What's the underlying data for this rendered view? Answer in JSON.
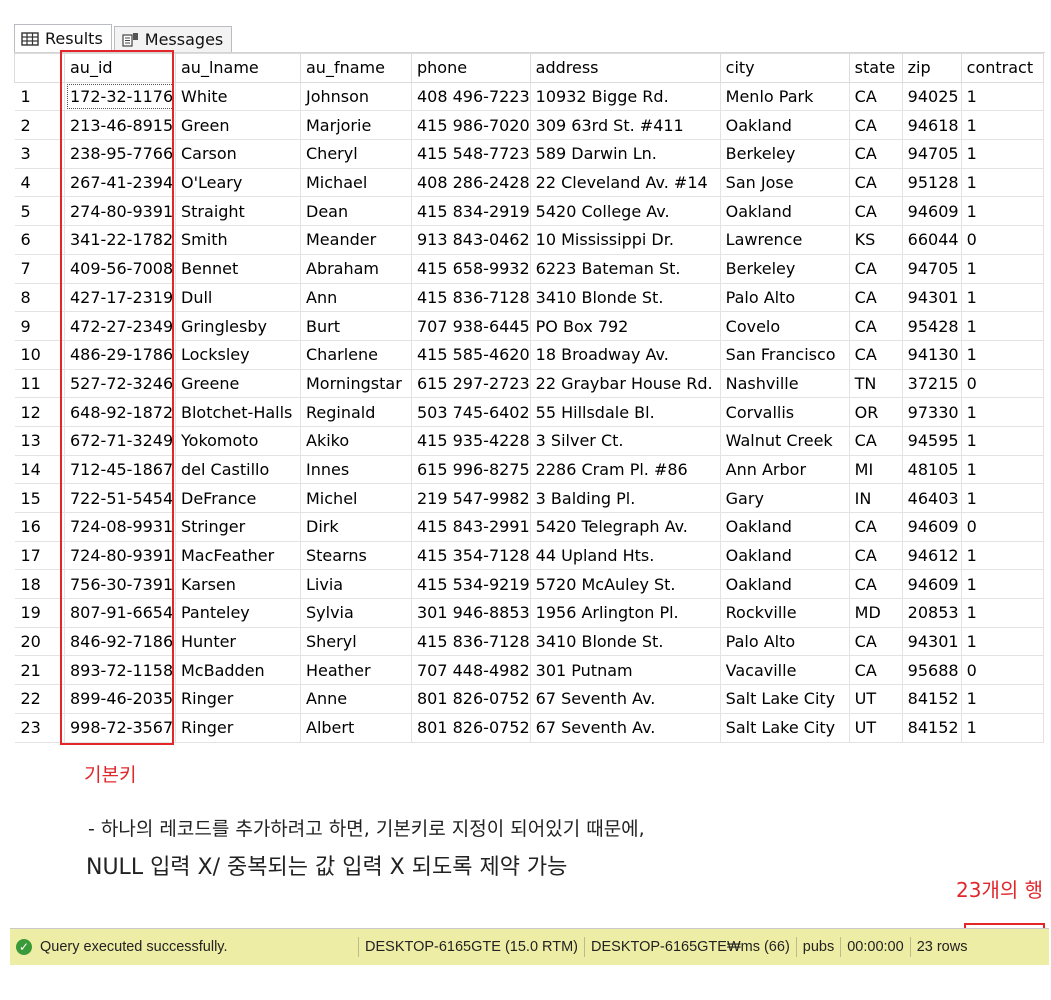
{
  "tabs": [
    {
      "label": "Results",
      "icon": "grid-icon"
    },
    {
      "label": "Messages",
      "icon": "messages-icon"
    }
  ],
  "columns": [
    "au_id",
    "au_lname",
    "au_fname",
    "phone",
    "address",
    "city",
    "state",
    "zip",
    "contract"
  ],
  "rows": [
    [
      "1",
      "172-32-1176",
      "White",
      "Johnson",
      "408 496-7223",
      "10932 Bigge Rd.",
      "Menlo Park",
      "CA",
      "94025",
      "1"
    ],
    [
      "2",
      "213-46-8915",
      "Green",
      "Marjorie",
      "415 986-7020",
      "309 63rd St. #411",
      "Oakland",
      "CA",
      "94618",
      "1"
    ],
    [
      "3",
      "238-95-7766",
      "Carson",
      "Cheryl",
      "415 548-7723",
      "589 Darwin Ln.",
      "Berkeley",
      "CA",
      "94705",
      "1"
    ],
    [
      "4",
      "267-41-2394",
      "O'Leary",
      "Michael",
      "408 286-2428",
      "22 Cleveland Av. #14",
      "San Jose",
      "CA",
      "95128",
      "1"
    ],
    [
      "5",
      "274-80-9391",
      "Straight",
      "Dean",
      "415 834-2919",
      "5420 College Av.",
      "Oakland",
      "CA",
      "94609",
      "1"
    ],
    [
      "6",
      "341-22-1782",
      "Smith",
      "Meander",
      "913 843-0462",
      "10 Mississippi Dr.",
      "Lawrence",
      "KS",
      "66044",
      "0"
    ],
    [
      "7",
      "409-56-7008",
      "Bennet",
      "Abraham",
      "415 658-9932",
      "6223 Bateman St.",
      "Berkeley",
      "CA",
      "94705",
      "1"
    ],
    [
      "8",
      "427-17-2319",
      "Dull",
      "Ann",
      "415 836-7128",
      "3410 Blonde St.",
      "Palo Alto",
      "CA",
      "94301",
      "1"
    ],
    [
      "9",
      "472-27-2349",
      "Gringlesby",
      "Burt",
      "707 938-6445",
      "PO Box 792",
      "Covelo",
      "CA",
      "95428",
      "1"
    ],
    [
      "10",
      "486-29-1786",
      "Locksley",
      "Charlene",
      "415 585-4620",
      "18 Broadway Av.",
      "San Francisco",
      "CA",
      "94130",
      "1"
    ],
    [
      "11",
      "527-72-3246",
      "Greene",
      "Morningstar",
      "615 297-2723",
      "22 Graybar House Rd.",
      "Nashville",
      "TN",
      "37215",
      "0"
    ],
    [
      "12",
      "648-92-1872",
      "Blotchet-Halls",
      "Reginald",
      "503 745-6402",
      "55 Hillsdale Bl.",
      "Corvallis",
      "OR",
      "97330",
      "1"
    ],
    [
      "13",
      "672-71-3249",
      "Yokomoto",
      "Akiko",
      "415 935-4228",
      "3 Silver Ct.",
      "Walnut Creek",
      "CA",
      "94595",
      "1"
    ],
    [
      "14",
      "712-45-1867",
      "del Castillo",
      "Innes",
      "615 996-8275",
      "2286 Cram Pl. #86",
      "Ann Arbor",
      "MI",
      "48105",
      "1"
    ],
    [
      "15",
      "722-51-5454",
      "DeFrance",
      "Michel",
      "219 547-9982",
      "3 Balding Pl.",
      "Gary",
      "IN",
      "46403",
      "1"
    ],
    [
      "16",
      "724-08-9931",
      "Stringer",
      "Dirk",
      "415 843-2991",
      "5420 Telegraph Av.",
      "Oakland",
      "CA",
      "94609",
      "0"
    ],
    [
      "17",
      "724-80-9391",
      "MacFeather",
      "Stearns",
      "415 354-7128",
      "44 Upland Hts.",
      "Oakland",
      "CA",
      "94612",
      "1"
    ],
    [
      "18",
      "756-30-7391",
      "Karsen",
      "Livia",
      "415 534-9219",
      "5720 McAuley St.",
      "Oakland",
      "CA",
      "94609",
      "1"
    ],
    [
      "19",
      "807-91-6654",
      "Panteley",
      "Sylvia",
      "301 946-8853",
      "1956 Arlington Pl.",
      "Rockville",
      "MD",
      "20853",
      "1"
    ],
    [
      "20",
      "846-92-7186",
      "Hunter",
      "Sheryl",
      "415 836-7128",
      "3410 Blonde St.",
      "Palo Alto",
      "CA",
      "94301",
      "1"
    ],
    [
      "21",
      "893-72-1158",
      "McBadden",
      "Heather",
      "707 448-4982",
      "301 Putnam",
      "Vacaville",
      "CA",
      "95688",
      "0"
    ],
    [
      "22",
      "899-46-2035",
      "Ringer",
      "Anne",
      "801 826-0752",
      "67 Seventh Av.",
      "Salt Lake City",
      "UT",
      "84152",
      "1"
    ],
    [
      "23",
      "998-72-3567",
      "Ringer",
      "Albert",
      "801 826-0752",
      "67 Seventh Av.",
      "Salt Lake City",
      "UT",
      "84152",
      "1"
    ]
  ],
  "annotations": {
    "primary_key_label": "기본키",
    "line1": "- 하나의 레코드를 추가하려고 하면, 기본키로 지정이 되어있기 때문에,",
    "line2": "NULL 입력 X/ 중복되는 값 입력 X 되도록 제약 가능",
    "row_count_note": "23개의 행"
  },
  "status": {
    "message": "Query executed successfully.",
    "server": "DESKTOP-6165GTE (15.0 RTM)",
    "user": "DESKTOP-6165GTE₩ms (66)",
    "database": "pubs",
    "elapsed": "00:00:00",
    "rows": "23 rows"
  },
  "colors": {
    "annotation_red": "#e2262a",
    "status_bar": "#eeeda6",
    "success_green": "#3a9a3a"
  }
}
